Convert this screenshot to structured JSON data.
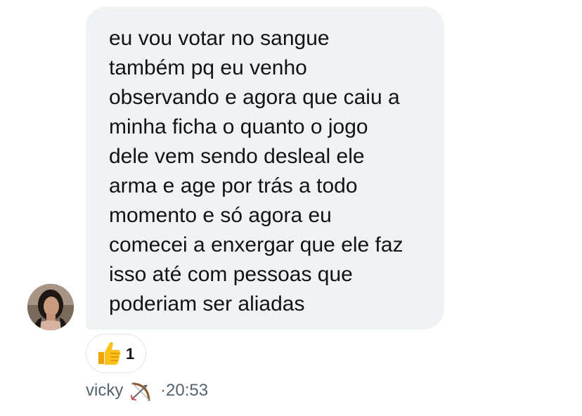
{
  "message": {
    "lines": [
      "eu vou votar no sangue",
      "também pq eu venho",
      "observando e agora que caiu a",
      "minha ficha o quanto o jogo",
      "dele vem sendo desleal ele",
      "arma e age por trás a todo",
      "momento e só agora eu",
      "comecei a enxergar que ele faz",
      "isso até com pessoas que",
      "poderiam ser aliadas"
    ]
  },
  "reaction": {
    "emoji_icon": "thumbs-up-icon",
    "count": "1"
  },
  "sender": {
    "name": "vicky",
    "badge_icon": "bow-and-arrow-icon",
    "time": "·20:53"
  },
  "colors": {
    "bubble": "#eff3f4",
    "text": "#0f1419",
    "meta": "#536471"
  }
}
